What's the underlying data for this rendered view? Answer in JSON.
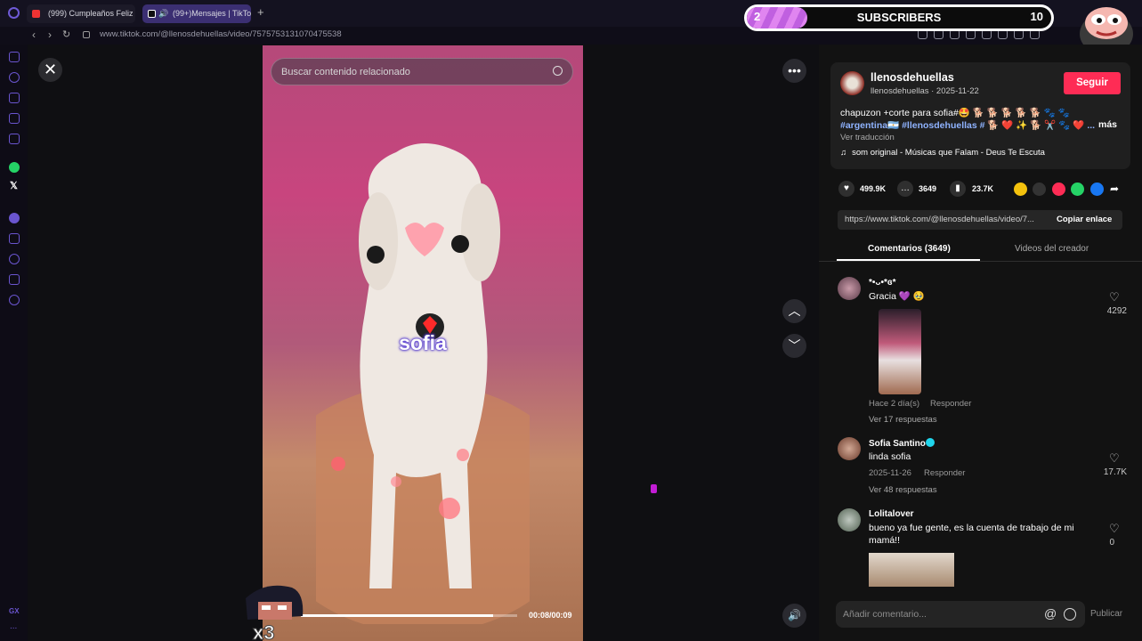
{
  "browser": {
    "tabs": [
      {
        "label": "(999) Cumpleaños Feliz -",
        "active": false
      },
      {
        "label": "(99+)Mensajes | TikTo",
        "active": true
      }
    ],
    "new_tab": "+",
    "url": "www.tiktok.com/@llenosdehuellas/video/7575753131070475538"
  },
  "sidebar": {
    "icons": [
      "messenger-icon",
      "history-icon",
      "flow-icon",
      "snapshot-icon",
      "news-icon",
      "whatsapp-icon",
      "x-icon",
      "music-icon",
      "bookmark-icon",
      "clock-icon",
      "extensions-icon",
      "settings-icon"
    ],
    "gx_label": "GX",
    "more": "..."
  },
  "video": {
    "search_placeholder": "Buscar contenido relacionado",
    "caption_overlay": "sofia",
    "time": "00:08/00:09",
    "progress": 0.89
  },
  "overlay": {
    "subs_current": "2",
    "subs_label": "SUBSCRIBERS",
    "subs_goal": "10",
    "subs_progress": 0.2,
    "emote_text": "x3"
  },
  "creator": {
    "name": "llenosdehuellas",
    "meta": "llenosdehuellas · 2025-11-22",
    "follow": "Seguir"
  },
  "description": {
    "line1": "chapuzon +corte para sofia#🤩 🐕 🐕 🐕 🐕 🐕 🐾 🐾",
    "line2": "#argentina🇦🇷 #llenosdehuellas # 🐕 ❤️ ✨ 🐕 ✂️ 🐾 ❤️ ...",
    "more": "más",
    "translate": "Ver traducción",
    "music": "som original - Músicas que Falam - Deus Te Escuta"
  },
  "stats": {
    "likes": "499.9K",
    "comments": "3649",
    "saves": "23.7K"
  },
  "share": {
    "link": "https://www.tiktok.com/@llenosdehuellas/video/7...",
    "copy": "Copiar enlace"
  },
  "panel_tabs": {
    "comments": "Comentarios (3649)",
    "creator_videos": "Videos del creador"
  },
  "comments": [
    {
      "user": "*•ᴗ•*ɞ*",
      "text": "Gracia 💜 🥹",
      "time": "Hace 2 día(s)",
      "reply": "Responder",
      "replies": "Ver 17 respuestas",
      "likes": "4292"
    },
    {
      "user": "Sofia Santino",
      "text": "linda sofia",
      "time": "2025-11-26",
      "reply": "Responder",
      "replies": "Ver 48 respuestas",
      "likes": "17.7K"
    },
    {
      "user": "Lolitalover",
      "text": "bueno ya fue gente, es la cuenta de trabajo de mi mamá!!",
      "likes": "0"
    }
  ],
  "composer": {
    "placeholder": "Añadir comentario...",
    "publish": "Publicar"
  },
  "colors": {
    "follow": "#fe2c55",
    "accent": "#6e5ad6",
    "hashtag": "#8fb3ff"
  }
}
